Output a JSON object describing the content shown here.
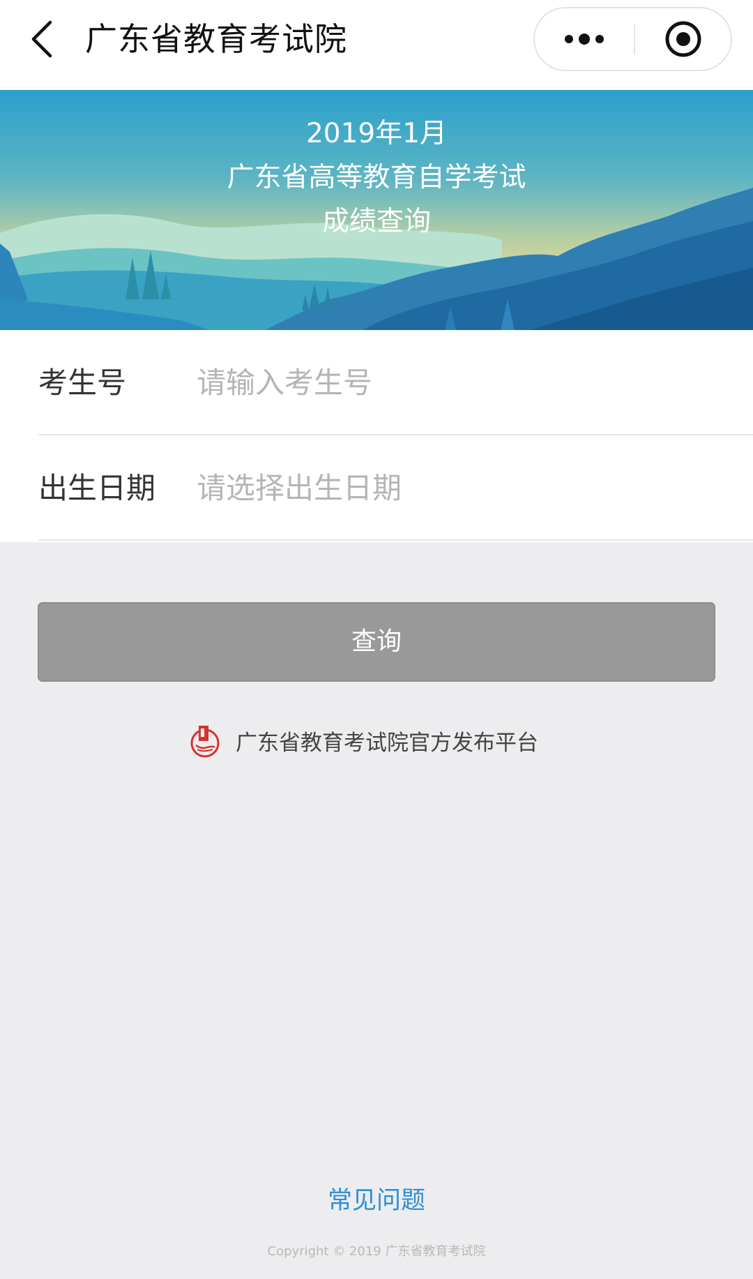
{
  "navbar": {
    "title": "广东省教育考试院",
    "back_icon": "chevron-left-icon",
    "more_icon": "more-dots-icon",
    "close_icon": "circle-target-icon"
  },
  "banner": {
    "line1": "2019年1月",
    "line2": "广东省高等教育自学考试",
    "line3": "成绩查询"
  },
  "form": {
    "candidate_label": "考生号",
    "candidate_placeholder": "请输入考生号",
    "birth_label": "出生日期",
    "birth_placeholder": "请选择出生日期"
  },
  "query_button": "查询",
  "official_platform": {
    "text": "广东省教育考试院官方发布平台",
    "logo_icon": "exam-authority-logo-icon"
  },
  "faq_link": "常见问题",
  "copyright": "Copyright © 2019 广东省教育考试院",
  "colors": {
    "page_background": "#ededef",
    "button_gray": "#999999",
    "link_blue": "#2d8ed8",
    "logo_red": "#d9302e"
  }
}
